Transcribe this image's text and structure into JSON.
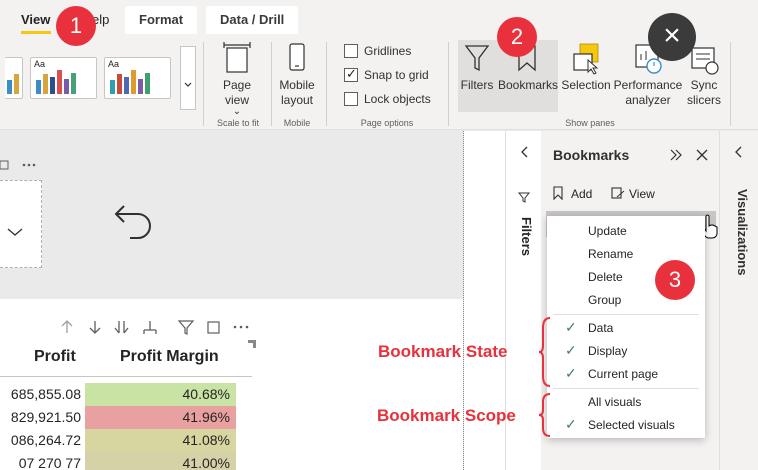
{
  "tabs": {
    "view": "View",
    "help": "elp",
    "format": "Format",
    "data_drill": "Data / Drill"
  },
  "themes": [
    {
      "aa": "Aa",
      "colors": [
        "#3a8ec7",
        "#d6a63c",
        "#2c4e8c",
        "#d94f4f",
        "#7a5ba8",
        "#46a07a"
      ]
    },
    {
      "aa": "Aa",
      "colors": [
        "#2e9fb0",
        "#c94a3a",
        "#4d69b0",
        "#e09b2d",
        "#7e5aa3",
        "#3fa06b"
      ]
    },
    {
      "aa": "Aa",
      "colors": [
        "#3a3a7a",
        "#5c6fbf",
        "#e0703d",
        "#c2405a",
        "#5fae5f",
        "#8b4fa0"
      ]
    }
  ],
  "ribbon": {
    "page_view": "Page view",
    "page_view_caret": "⌄",
    "scale_to_fit": "Scale to fit",
    "mobile_layout": "Mobile layout",
    "mobile": "Mobile",
    "gridlines": "Gridlines",
    "snap_to_grid": "Snap to grid",
    "lock_objects": "Lock objects",
    "page_options": "Page options",
    "filters": "Filters",
    "bookmarks": "Bookmarks",
    "selection": "Selection",
    "performance_analyzer": "Performance analyzer",
    "sync_slicers": "Sync slicers",
    "show_panes": "Show panes"
  },
  "panes": {
    "filters_title": "Filters",
    "bookmarks_title": "Bookmarks",
    "add": "Add",
    "view": "View",
    "visualizations_title": "Visualizations"
  },
  "table": {
    "col_profit": "Profit",
    "col_margin": "Profit Margin",
    "rows": [
      {
        "profit": "685,855.08",
        "margin": "40.68%",
        "color": "#c9e3a4"
      },
      {
        "profit": "829,921.50",
        "margin": "41.96%",
        "color": "#e8a0a0"
      },
      {
        "profit": "086,264.72",
        "margin": "41.08%",
        "color": "#d8d6a0"
      },
      {
        "profit": "07 270 77",
        "margin": "41.00%",
        "color": "#d6d2a8"
      }
    ]
  },
  "menu": {
    "update": "Update",
    "rename": "Rename",
    "delete": "Delete",
    "group": "Group",
    "data": "Data",
    "display": "Display",
    "current_page": "Current page",
    "all_visuals": "All visuals",
    "selected_visuals": "Selected visuals"
  },
  "annotations": {
    "badge1": "1",
    "badge2": "2",
    "badge3": "3",
    "close": "×",
    "bookmark_state": "Bookmark State",
    "bookmark_scope": "Bookmark Scope"
  },
  "colors": {
    "accent_yellow": "#f2c811",
    "badge_red": "#e8313c"
  }
}
